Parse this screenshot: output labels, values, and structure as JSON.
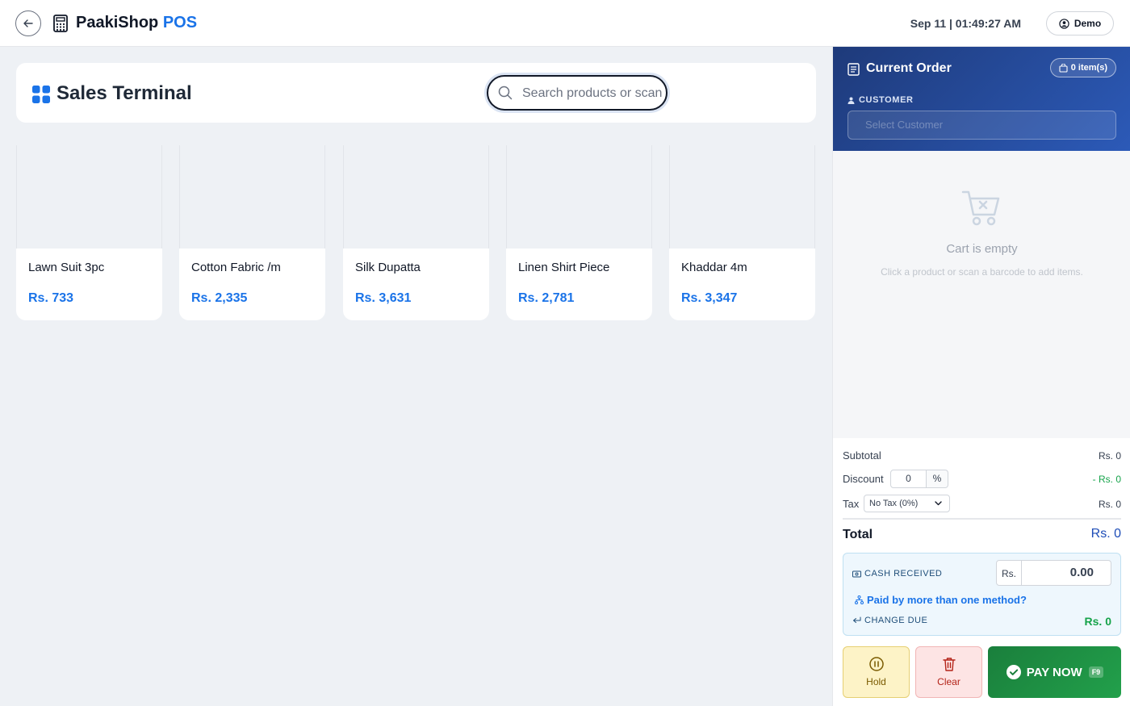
{
  "app": {
    "brand_name": "PaakiShop",
    "brand_suffix": "POS",
    "clock": "Sep 11 | 01:49:27 AM",
    "user_name": "Demo"
  },
  "terminal": {
    "title": "Sales Terminal",
    "search_placeholder": "Search products or scan barcode..."
  },
  "products": [
    {
      "name": "Lawn Suit 3pc",
      "price": "Rs. 733"
    },
    {
      "name": "Cotton Fabric /m",
      "price": "Rs. 2,335"
    },
    {
      "name": "Silk Dupatta",
      "price": "Rs. 3,631"
    },
    {
      "name": "Linen Shirt Piece",
      "price": "Rs. 2,781"
    },
    {
      "name": "Khaddar 4m",
      "price": "Rs. 3,347"
    }
  ],
  "order": {
    "title": "Current Order",
    "items_badge": "0 item(s)",
    "customer_label": "CUSTOMER",
    "customer_placeholder": "Select Customer",
    "empty_title": "Cart is empty",
    "empty_hint": "Click a product or scan a barcode to add items.",
    "subtotal_label": "Subtotal",
    "subtotal_value": "Rs. 0",
    "discount_label": "Discount",
    "discount_input": "0",
    "discount_unit": "%",
    "discount_value": "- Rs. 0",
    "tax_label": "Tax",
    "tax_option": "No Tax (0%)",
    "tax_value": "Rs. 0",
    "total_label": "Total",
    "total_value": "Rs. 0",
    "cash_label": "CASH RECEIVED",
    "cash_prefix": "Rs.",
    "cash_value": "0.00",
    "split_link": "Paid by more than one method?",
    "change_label": "CHANGE DUE",
    "change_value": "Rs. 0",
    "hold_label": "Hold",
    "clear_label": "Clear",
    "pay_label": "PAY NOW",
    "pay_key": "F9"
  },
  "colors": {
    "accent": "#1a73e8",
    "order_header": "#1e3a7a",
    "pay": "#1a7f3c",
    "discount_green": "#16a34a"
  }
}
